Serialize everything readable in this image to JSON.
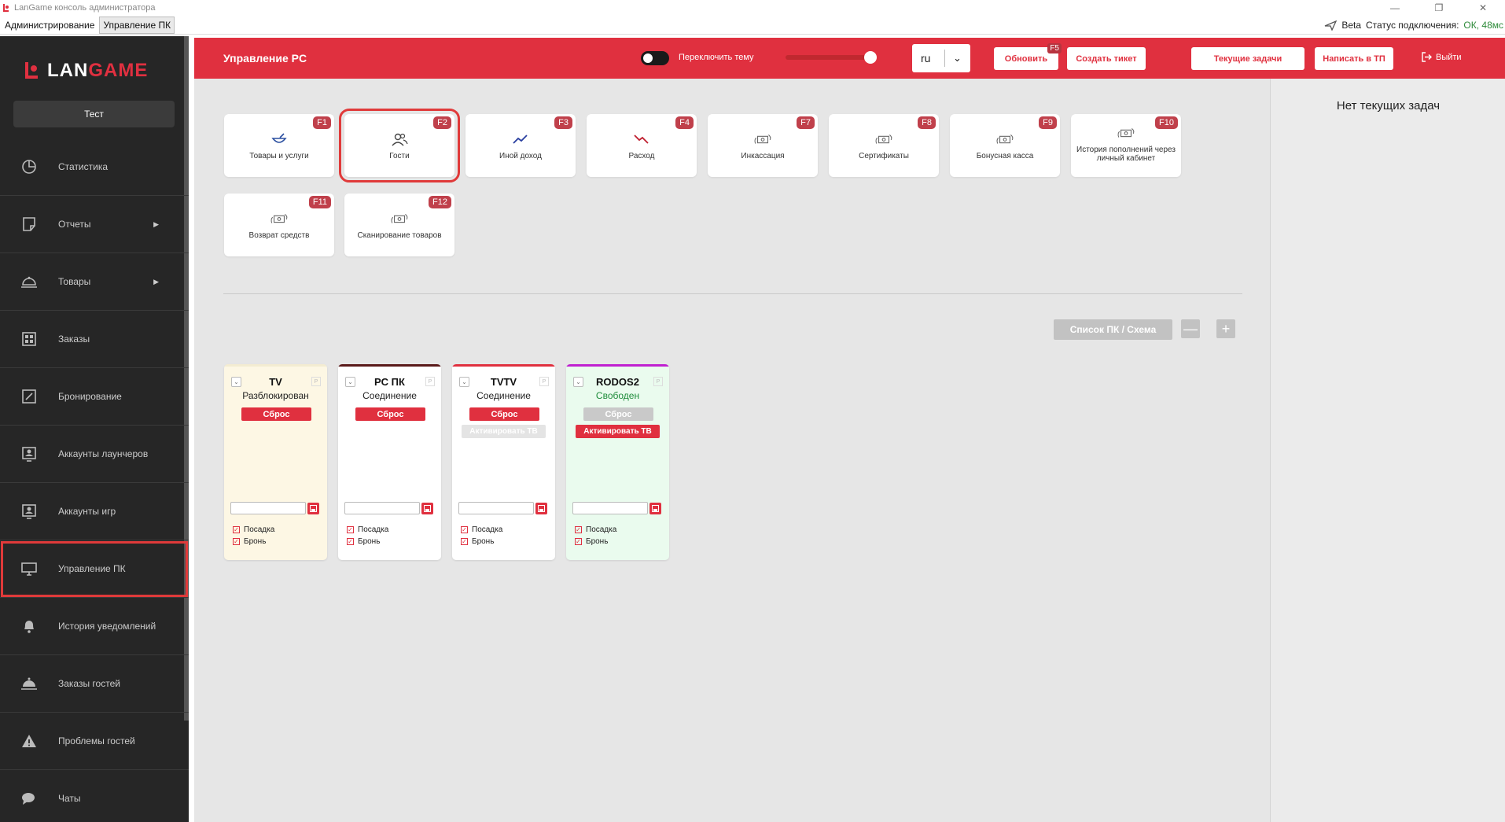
{
  "window": {
    "title": "LanGame консоль администратора",
    "controls": [
      "—",
      "❐",
      "✕"
    ]
  },
  "menubar": {
    "tabs": [
      "Администрирование",
      "Управление ПК"
    ],
    "beta": "Beta",
    "status_label": "Статус подключения:",
    "status_value": "ОК, 48мс"
  },
  "sidebar": {
    "brand": "LANGAME",
    "club": "Тест",
    "items": [
      {
        "label": "Статистика",
        "icon": "pie-chart-icon"
      },
      {
        "label": "Отчеты",
        "icon": "document-icon",
        "arrow": "▶"
      },
      {
        "label": "Товары",
        "icon": "cloche-icon",
        "arrow": "▶"
      },
      {
        "label": "Заказы",
        "icon": "grid-icon"
      },
      {
        "label": "Бронирование",
        "icon": "edit-icon"
      },
      {
        "label": "Аккаунты лаунчеров",
        "icon": "user-card-icon"
      },
      {
        "label": "Аккаунты игр",
        "icon": "user-card-icon"
      },
      {
        "label": "Управление ПК",
        "icon": "monitor-icon"
      },
      {
        "label": "История уведомлений",
        "icon": "bell-icon"
      },
      {
        "label": "Заказы гостей",
        "icon": "cloche-icon"
      },
      {
        "label": "Проблемы гостей",
        "icon": "warning-icon"
      },
      {
        "label": "Чаты",
        "icon": "chat-icon"
      }
    ]
  },
  "header": {
    "title": "Управление PC",
    "theme_toggle_label": "Переключить тему",
    "language": "ru",
    "refresh": "Обновить",
    "refresh_key": "F5",
    "create_ticket": "Создать тикет",
    "current_tasks": "Текущие задачи",
    "write_support": "Написать в ТП",
    "logout": "Выйти"
  },
  "actions": [
    {
      "label": "Товары и услуги",
      "key": "F1",
      "icon": "bowl-icon"
    },
    {
      "label": "Гости",
      "key": "F2",
      "icon": "users-icon"
    },
    {
      "label": "Иной доход",
      "key": "F3",
      "icon": "trend-up-icon"
    },
    {
      "label": "Расход",
      "key": "F4",
      "icon": "trend-down-icon"
    },
    {
      "label": "Инкассация",
      "key": "F7",
      "icon": "money-transfer-icon"
    },
    {
      "label": "Сертификаты",
      "key": "F8",
      "icon": "money-transfer-icon"
    },
    {
      "label": "Бонусная касса",
      "key": "F9",
      "icon": "money-transfer-icon"
    },
    {
      "label": "История пополнений через личный кабинет",
      "key": "F10",
      "icon": "money-transfer-icon"
    },
    {
      "label": "Возврат средств",
      "key": "F11",
      "icon": "money-transfer-icon"
    },
    {
      "label": "Сканирование товаров",
      "key": "F12",
      "icon": "money-transfer-icon"
    }
  ],
  "schema": {
    "toggle": "Список ПК / Схема",
    "minus": "—",
    "plus": "+"
  },
  "pcs": [
    {
      "name": "TV",
      "status": "Разблокирован",
      "reset": "Сброс",
      "activate": "",
      "badge": "P",
      "check1": "Посадка",
      "check2": "Бронь",
      "accent": "#f0f0e0",
      "bg": "#fdf7e4"
    },
    {
      "name": "PC ПК",
      "status": "Соединение",
      "reset": "Сброс",
      "activate": "",
      "badge": "P",
      "check1": "Посадка",
      "check2": "Бронь",
      "accent": "#5a1a1a",
      "bg": "#ffffff"
    },
    {
      "name": "TVTV",
      "status": "Соединение",
      "reset": "Сброс",
      "activate": "Активировать ТВ",
      "badge": "P",
      "check1": "Посадка",
      "check2": "Бронь",
      "accent": "#e0303f",
      "bg": "#ffffff"
    },
    {
      "name": "RODOS2",
      "status": "Свободен",
      "reset": "Сброс",
      "activate": "Активировать ТВ",
      "badge": "P",
      "check1": "Посадка",
      "check2": "Бронь",
      "accent": "#c020d0",
      "bg": "#eafbee"
    }
  ],
  "right_panel": {
    "no_tasks": "Нет текущих задач"
  }
}
